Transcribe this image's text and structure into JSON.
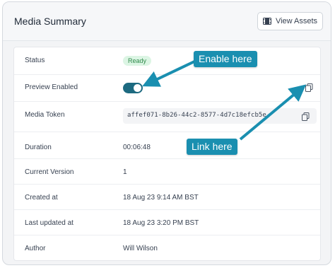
{
  "header": {
    "title": "Media Summary",
    "view_assets_label": "View Assets",
    "view_assets_icon": "film-icon"
  },
  "rows": {
    "status": {
      "label": "Status",
      "value": "Ready"
    },
    "preview": {
      "label": "Preview Enabled",
      "enabled": true
    },
    "token": {
      "label": "Media Token",
      "value": "affef071-8b26-44c2-8577-4d7c18efcb5e"
    },
    "duration": {
      "label": "Duration",
      "value": "00:06:48"
    },
    "version": {
      "label": "Current Version",
      "value": "1"
    },
    "created": {
      "label": "Created at",
      "value": "18 Aug 23 9:14 AM BST"
    },
    "updated": {
      "label": "Last updated at",
      "value": "18 Aug 23 3:20 PM BST"
    },
    "author": {
      "label": "Author",
      "value": "Will Wilson"
    }
  },
  "annotations": {
    "enable_here": "Enable here",
    "link_here": "Link here"
  },
  "colors": {
    "accent": "#1d6a80",
    "callout": "#1a8fb0",
    "badge_bg": "#dcf5e4",
    "badge_text": "#2f8a4b"
  }
}
